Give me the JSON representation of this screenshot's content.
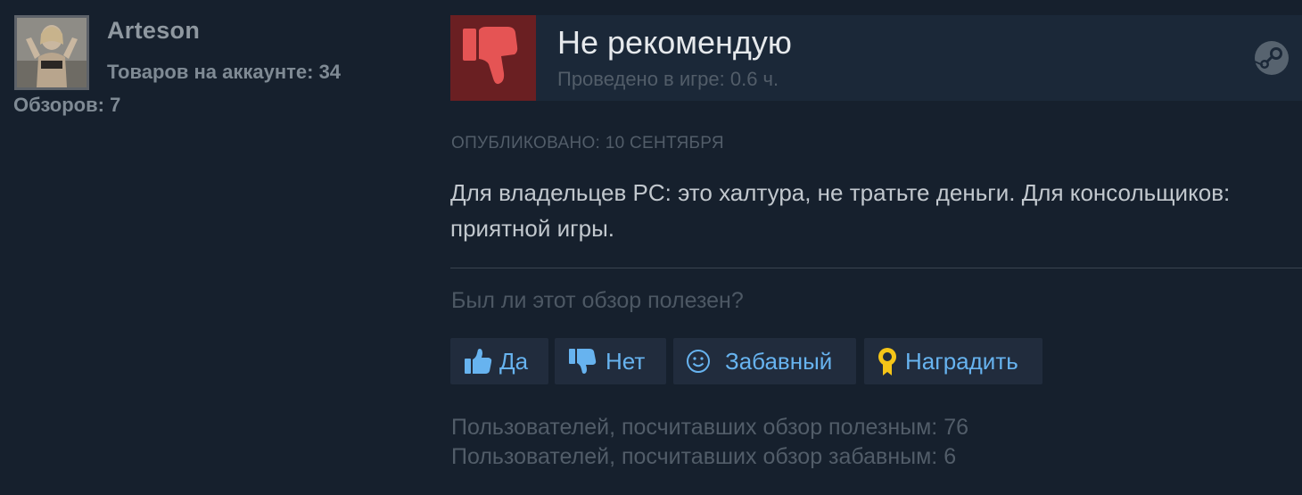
{
  "author": {
    "name": "Arteson",
    "products_label": "Товаров на аккаунте: 34",
    "reviews_label": "Обзоров: 7"
  },
  "review": {
    "verdict": "Не рекомендую",
    "playtime": "Проведено в игре: 0.6 ч.",
    "posted": "Опубликовано: 10 сентября",
    "text": "Для владельцев PC: это халтура, не тратьте деньги. Для консольщиков: приятной игры."
  },
  "feedback": {
    "question": "Был ли этот обзор полезен?",
    "yes_label": "Да",
    "no_label": "Нет",
    "funny_label": "Забавный",
    "award_label": "Наградить"
  },
  "stats": {
    "helpful": "Пользователей, посчитавших обзор полезным: 76",
    "funny": "Пользователей, посчитавших обзор забавным: 6"
  },
  "icons": {
    "verdict": "thumbs-down-icon",
    "platform": "steam-icon",
    "yes": "thumbs-up-icon",
    "no": "thumbs-down-icon",
    "funny": "smiley-icon",
    "award": "award-icon"
  },
  "colors": {
    "background": "#16202d",
    "verdict_box": "#6a1f22",
    "thumb_down": "#e55454",
    "link_blue": "#67b3ef",
    "award_gold": "#f5c518"
  }
}
